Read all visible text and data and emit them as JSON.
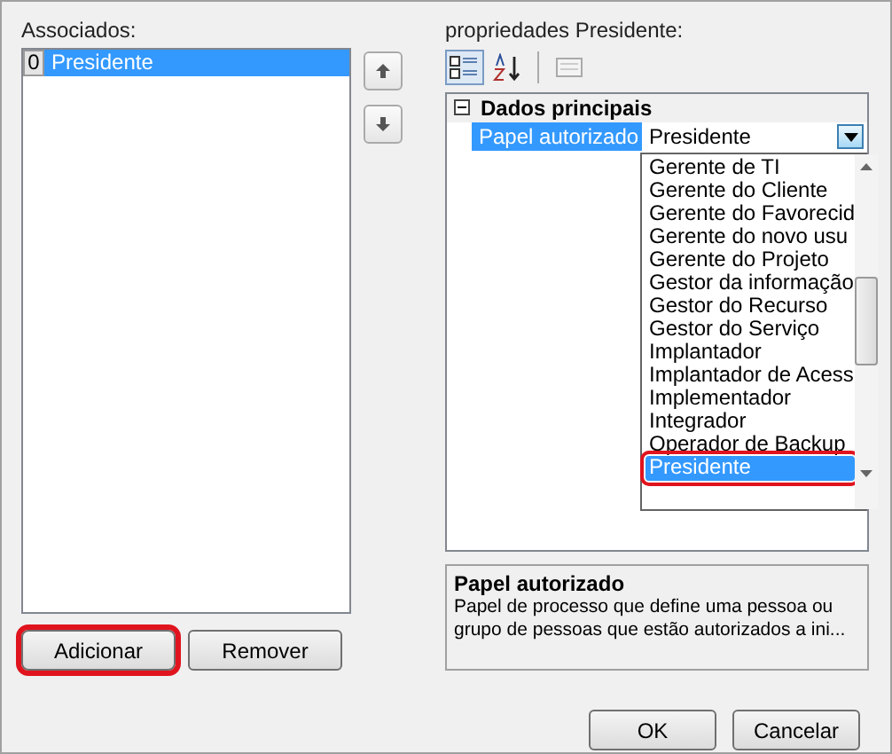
{
  "left": {
    "label": "Associados:",
    "items": [
      {
        "index": "0",
        "name": "Presidente",
        "selected": true
      }
    ],
    "buttons": [
      {
        "label": "Adicionar",
        "highlighted": true
      },
      {
        "label": "Remover",
        "highlighted": false
      }
    ]
  },
  "right": {
    "label": "propriedades Presidente:",
    "toolbar": [
      {
        "kind": "categorized",
        "selected": true
      },
      {
        "kind": "alphabetical",
        "selected": false
      },
      {
        "kind": "pages",
        "selected": false
      }
    ],
    "category": {
      "title": "Dados principais",
      "expanded": true
    },
    "property": {
      "name": "Papel autorizado",
      "value": "Presidente",
      "selected": true
    },
    "dropdown": [
      {
        "label": "Gerente de TI",
        "selected": false,
        "highlighted": false
      },
      {
        "label": "Gerente do Cliente",
        "selected": false,
        "highlighted": false
      },
      {
        "label": "Gerente do Favorecid",
        "selected": false,
        "highlighted": false
      },
      {
        "label": "Gerente do novo usu",
        "selected": false,
        "highlighted": false
      },
      {
        "label": "Gerente do Projeto",
        "selected": false,
        "highlighted": false
      },
      {
        "label": "Gestor da informação",
        "selected": false,
        "highlighted": false
      },
      {
        "label": "Gestor do Recurso",
        "selected": false,
        "highlighted": false
      },
      {
        "label": "Gestor do Serviço",
        "selected": false,
        "highlighted": false
      },
      {
        "label": "Implantador",
        "selected": false,
        "highlighted": false
      },
      {
        "label": "Implantador de Acess",
        "selected": false,
        "highlighted": false
      },
      {
        "label": "Implementador",
        "selected": false,
        "highlighted": false
      },
      {
        "label": "Integrador",
        "selected": false,
        "highlighted": false
      },
      {
        "label": "Operador de Backup",
        "selected": false,
        "highlighted": false
      },
      {
        "label": "Presidente",
        "selected": true,
        "highlighted": true
      }
    ],
    "description": {
      "title": "Papel autorizado",
      "text": "Papel de processo que define uma pessoa ou grupo de pessoas que estão autorizados a ini..."
    }
  },
  "buttons": [
    {
      "label": "OK"
    },
    {
      "label": "Cancelar"
    }
  ]
}
